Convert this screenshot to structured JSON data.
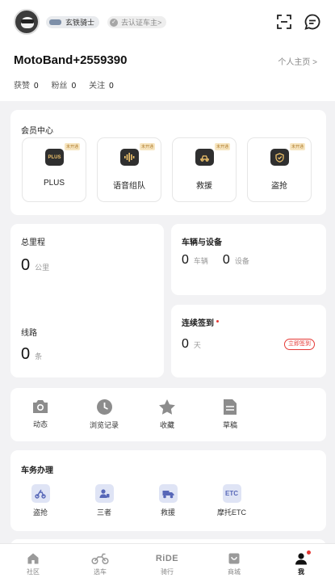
{
  "profile": {
    "rank_badge": "玄铁骑士",
    "cert_badge": "去认证车主>",
    "username": "MotoBand+2559390",
    "homepage_link": "个人主页 >",
    "stats": [
      {
        "label": "获赞",
        "value": "0"
      },
      {
        "label": "粉丝",
        "value": "0"
      },
      {
        "label": "关注",
        "value": "0"
      }
    ]
  },
  "member_center": {
    "title": "会员中心",
    "items": [
      {
        "label": "PLUS",
        "badge": "未开通",
        "icon": "plus-icon",
        "icon_text": "PLUS"
      },
      {
        "label": "语音组队",
        "badge": "未开通",
        "icon": "voice-team-icon"
      },
      {
        "label": "救援",
        "badge": "未开通",
        "icon": "rescue-icon"
      },
      {
        "label": "盗抢",
        "badge": "未开通",
        "icon": "anti-theft-icon"
      }
    ]
  },
  "odometer": {
    "title": "总里程",
    "value": "0",
    "unit": "公里",
    "route_title": "线路",
    "route_value": "0",
    "route_unit": "条"
  },
  "vehicles": {
    "title": "车辆与设备",
    "vehicle_count": "0",
    "vehicle_unit": "车辆",
    "device_count": "0",
    "device_unit": "设备"
  },
  "checkin": {
    "title": "连续签到",
    "value": "0",
    "unit": "天",
    "button": "立即签到"
  },
  "tools": [
    {
      "label": "动态",
      "icon": "camera-icon"
    },
    {
      "label": "浏览记录",
      "icon": "clock-icon"
    },
    {
      "label": "收藏",
      "icon": "star-icon"
    },
    {
      "label": "草稿",
      "icon": "draft-icon"
    }
  ],
  "vehicle_services": {
    "title": "车务办理",
    "items": [
      {
        "label": "盗抢",
        "icon": "theft-service-icon"
      },
      {
        "label": "三者",
        "icon": "third-party-icon"
      },
      {
        "label": "救援",
        "icon": "tow-truck-icon"
      },
      {
        "label": "摩托ETC",
        "icon": "etc-icon",
        "icon_text": "ETC"
      }
    ]
  },
  "tabbar": [
    {
      "label": "社区",
      "icon": "home-icon"
    },
    {
      "label": "选车",
      "icon": "motorcycle-icon"
    },
    {
      "label": "骑行",
      "icon": "ride-logo",
      "icon_text": "RiDE"
    },
    {
      "label": "商城",
      "icon": "shop-icon"
    },
    {
      "label": "我",
      "icon": "profile-icon",
      "active": true
    }
  ],
  "colors": {
    "accent_red": "#e53935",
    "badge_gold": "#f0c36b",
    "service_blue": "#5767b8"
  }
}
